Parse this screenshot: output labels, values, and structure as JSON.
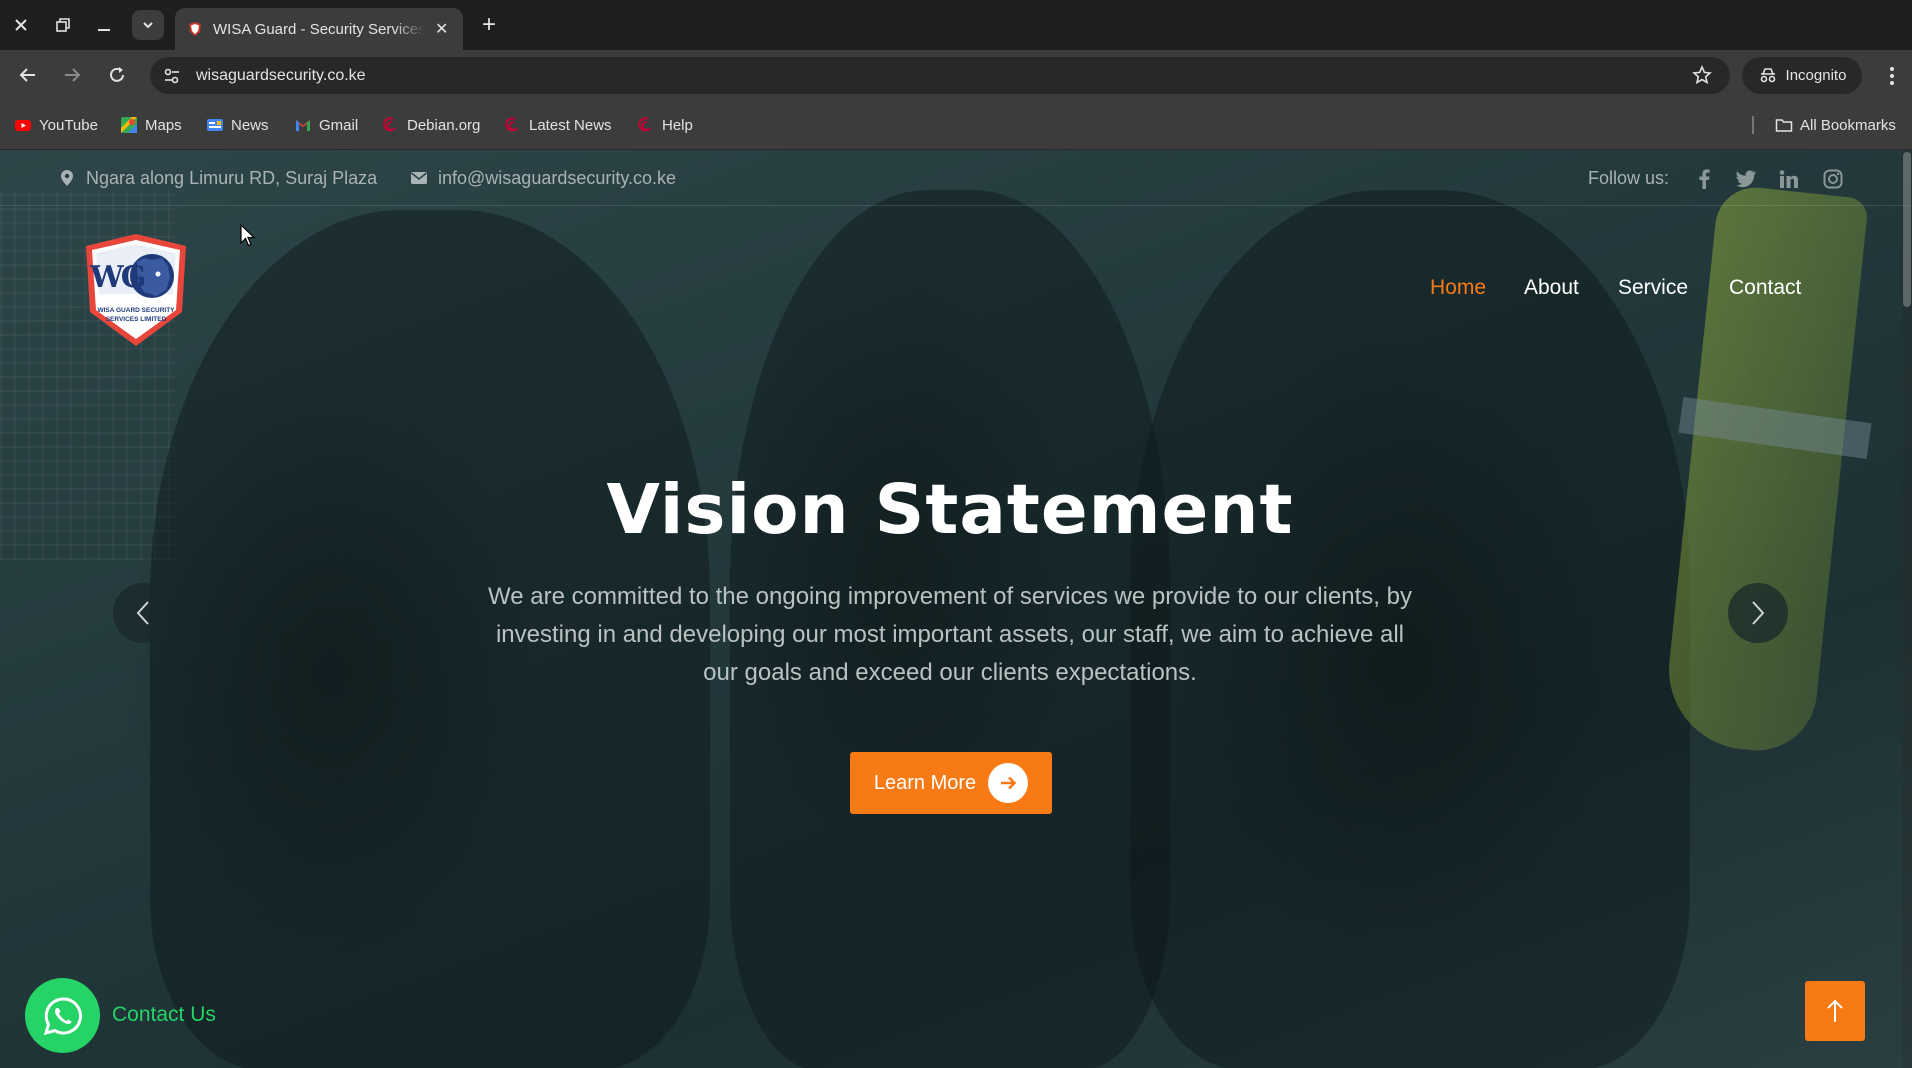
{
  "browser": {
    "tab_title": "WISA Guard - Security Services",
    "url": "wisaguardsecurity.co.ke",
    "incognito_label": "Incognito",
    "new_tab_symbol": "+",
    "close_symbol": "✕",
    "bookmarks": [
      {
        "label": "YouTube",
        "icon": "youtube-icon",
        "color": "#ff0000"
      },
      {
        "label": "Maps",
        "icon": "maps-icon",
        "color": "#34a853"
      },
      {
        "label": "News",
        "icon": "news-icon",
        "color": "#4285f4"
      },
      {
        "label": "Gmail",
        "icon": "gmail-icon",
        "color": "#ea4335"
      },
      {
        "label": "Debian.org",
        "icon": "debian-icon",
        "color": "#c70036"
      },
      {
        "label": "Latest News",
        "icon": "debian-icon",
        "color": "#c70036"
      },
      {
        "label": "Help",
        "icon": "debian-icon",
        "color": "#c70036"
      }
    ],
    "all_bookmarks_label": "All Bookmarks"
  },
  "topbar": {
    "address": "Ngara along Limuru RD, Suraj Plaza",
    "email": "info@wisaguardsecurity.co.ke",
    "follow_label": "Follow us:",
    "socials": [
      "facebook-icon",
      "twitter-icon",
      "linkedin-icon",
      "instagram-icon"
    ]
  },
  "logo": {
    "initials": "WG",
    "line1": "WISA GUARD SECURITY",
    "line2": "SERVICES LIMITED"
  },
  "nav": {
    "items": [
      "Home",
      "About",
      "Service",
      "Contact"
    ],
    "active": "Home"
  },
  "hero": {
    "title": "Vision Statement",
    "text": "We are committed to the ongoing improvement of services we provide to our clients, by investing in and developing our most important assets, our staff, we aim to achieve all our goals and exceed our clients expectations.",
    "cta_label": "Learn More"
  },
  "whatsapp": {
    "label": "Contact Us"
  },
  "colors": {
    "accent": "#f87a15",
    "whatsapp": "#25d366"
  }
}
